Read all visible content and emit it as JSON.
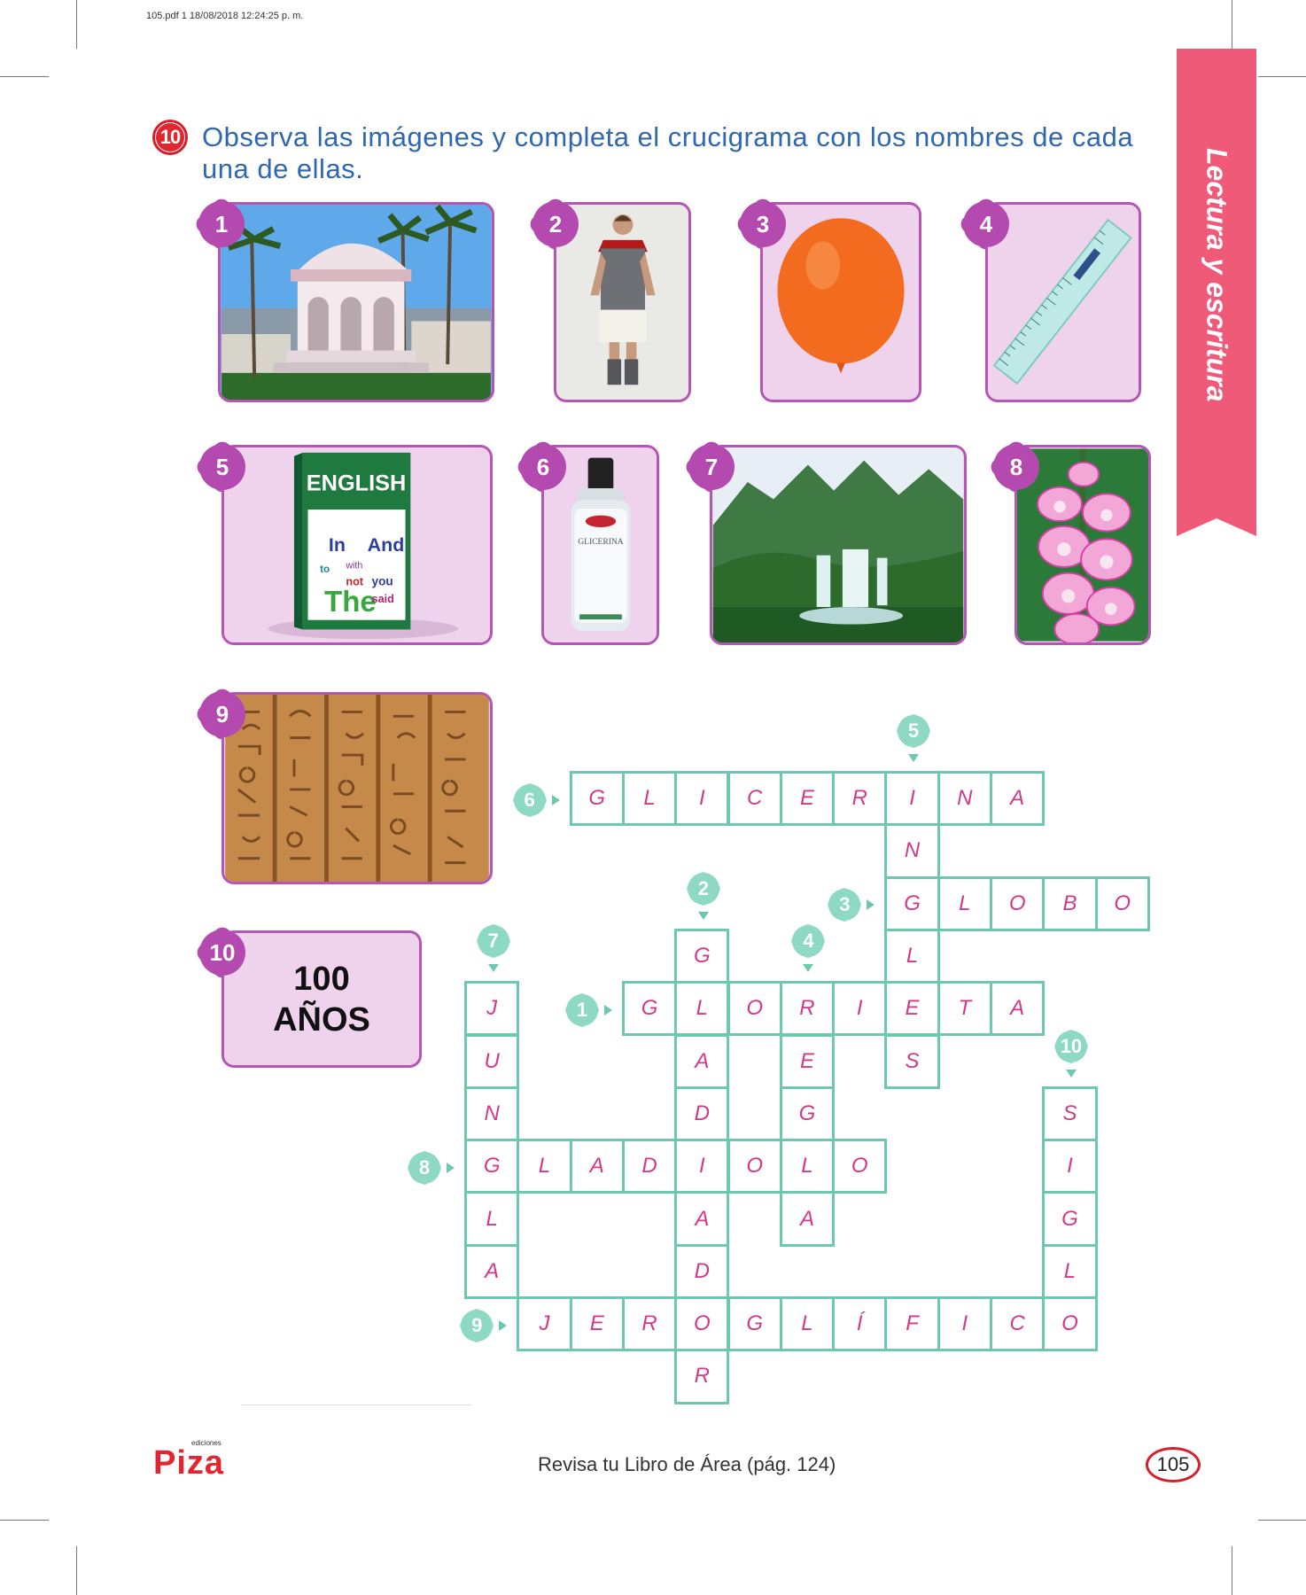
{
  "header": {
    "file_info": "105.pdf   1   18/08/2018   12:24:25 p. m."
  },
  "side_tab": {
    "label": "Lectura y escritura"
  },
  "exercise": {
    "number": "10",
    "instruction": "Observa las imágenes y completa el crucigrama con los nombres de cada una de ellas."
  },
  "images": [
    {
      "number": "1",
      "icon": "gazebo-photo"
    },
    {
      "number": "2",
      "icon": "gladiator-photo"
    },
    {
      "number": "3",
      "icon": "orange-balloon"
    },
    {
      "number": "4",
      "icon": "ruler"
    },
    {
      "number": "5",
      "icon": "english-book"
    },
    {
      "number": "6",
      "icon": "glycerin-bottle"
    },
    {
      "number": "7",
      "icon": "jungle-waterfall-photo"
    },
    {
      "number": "8",
      "icon": "gladiolus-flower"
    },
    {
      "number": "9",
      "icon": "hieroglyphics-photo"
    },
    {
      "number": "10",
      "icon": "text-card"
    }
  ],
  "book_cover": {
    "title": "ENGLISH",
    "words": [
      "In",
      "And",
      "The",
      "you",
      "said",
      "not",
      "to",
      "with"
    ]
  },
  "bottle_label": "GLICERINA",
  "card10": {
    "line1": "100",
    "line2": "AÑOS"
  },
  "crossword": {
    "cells": [
      {
        "r": 0,
        "c": 2,
        "ch": "G"
      },
      {
        "r": 0,
        "c": 3,
        "ch": "L"
      },
      {
        "r": 0,
        "c": 4,
        "ch": "I"
      },
      {
        "r": 0,
        "c": 5,
        "ch": "C"
      },
      {
        "r": 0,
        "c": 6,
        "ch": "E"
      },
      {
        "r": 0,
        "c": 7,
        "ch": "R"
      },
      {
        "r": 0,
        "c": 8,
        "ch": "I"
      },
      {
        "r": 0,
        "c": 9,
        "ch": "N"
      },
      {
        "r": 0,
        "c": 10,
        "ch": "A"
      },
      {
        "r": 1,
        "c": 8,
        "ch": "N"
      },
      {
        "r": 2,
        "c": 8,
        "ch": "G"
      },
      {
        "r": 2,
        "c": 9,
        "ch": "L"
      },
      {
        "r": 2,
        "c": 10,
        "ch": "O"
      },
      {
        "r": 2,
        "c": 11,
        "ch": "B"
      },
      {
        "r": 2,
        "c": 12,
        "ch": "O"
      },
      {
        "r": 3,
        "c": 4,
        "ch": "G"
      },
      {
        "r": 3,
        "c": 8,
        "ch": "L"
      },
      {
        "r": 4,
        "c": 0,
        "ch": "J"
      },
      {
        "r": 4,
        "c": 3,
        "ch": "G"
      },
      {
        "r": 4,
        "c": 4,
        "ch": "L"
      },
      {
        "r": 4,
        "c": 5,
        "ch": "O"
      },
      {
        "r": 4,
        "c": 6,
        "ch": "R"
      },
      {
        "r": 4,
        "c": 7,
        "ch": "I"
      },
      {
        "r": 4,
        "c": 8,
        "ch": "E"
      },
      {
        "r": 4,
        "c": 9,
        "ch": "T"
      },
      {
        "r": 4,
        "c": 10,
        "ch": "A"
      },
      {
        "r": 5,
        "c": 0,
        "ch": "U"
      },
      {
        "r": 5,
        "c": 4,
        "ch": "A"
      },
      {
        "r": 5,
        "c": 6,
        "ch": "E"
      },
      {
        "r": 5,
        "c": 8,
        "ch": "S"
      },
      {
        "r": 6,
        "c": 0,
        "ch": "N"
      },
      {
        "r": 6,
        "c": 4,
        "ch": "D"
      },
      {
        "r": 6,
        "c": 6,
        "ch": "G"
      },
      {
        "r": 6,
        "c": 11,
        "ch": "S"
      },
      {
        "r": 7,
        "c": 0,
        "ch": "G"
      },
      {
        "r": 7,
        "c": 1,
        "ch": "L"
      },
      {
        "r": 7,
        "c": 2,
        "ch": "A"
      },
      {
        "r": 7,
        "c": 3,
        "ch": "D"
      },
      {
        "r": 7,
        "c": 4,
        "ch": "I"
      },
      {
        "r": 7,
        "c": 5,
        "ch": "O"
      },
      {
        "r": 7,
        "c": 6,
        "ch": "L"
      },
      {
        "r": 7,
        "c": 7,
        "ch": "O"
      },
      {
        "r": 7,
        "c": 11,
        "ch": "I"
      },
      {
        "r": 8,
        "c": 0,
        "ch": "L"
      },
      {
        "r": 8,
        "c": 4,
        "ch": "A"
      },
      {
        "r": 8,
        "c": 6,
        "ch": "A"
      },
      {
        "r": 8,
        "c": 11,
        "ch": "G"
      },
      {
        "r": 9,
        "c": 0,
        "ch": "A"
      },
      {
        "r": 9,
        "c": 4,
        "ch": "D"
      },
      {
        "r": 9,
        "c": 11,
        "ch": "L"
      },
      {
        "r": 10,
        "c": 1,
        "ch": "J"
      },
      {
        "r": 10,
        "c": 2,
        "ch": "E"
      },
      {
        "r": 10,
        "c": 3,
        "ch": "R"
      },
      {
        "r": 10,
        "c": 4,
        "ch": "O"
      },
      {
        "r": 10,
        "c": 5,
        "ch": "G"
      },
      {
        "r": 10,
        "c": 6,
        "ch": "L"
      },
      {
        "r": 10,
        "c": 7,
        "ch": "Í"
      },
      {
        "r": 10,
        "c": 8,
        "ch": "F"
      },
      {
        "r": 10,
        "c": 9,
        "ch": "I"
      },
      {
        "r": 10,
        "c": 10,
        "ch": "C"
      },
      {
        "r": 10,
        "c": 11,
        "ch": "O"
      },
      {
        "r": 11,
        "c": 4,
        "ch": "R"
      }
    ],
    "clues": [
      {
        "n": "6",
        "dir": "across",
        "r": 0,
        "c": 2
      },
      {
        "n": "5",
        "dir": "down",
        "r": 0,
        "c": 8
      },
      {
        "n": "3",
        "dir": "across",
        "r": 2,
        "c": 8
      },
      {
        "n": "2",
        "dir": "down",
        "r": 3,
        "c": 4
      },
      {
        "n": "4",
        "dir": "down",
        "r": 4,
        "c": 6
      },
      {
        "n": "7",
        "dir": "down",
        "r": 4,
        "c": 0
      },
      {
        "n": "1",
        "dir": "across",
        "r": 4,
        "c": 3
      },
      {
        "n": "10",
        "dir": "down",
        "r": 6,
        "c": 11
      },
      {
        "n": "8",
        "dir": "across",
        "r": 7,
        "c": 0
      },
      {
        "n": "9",
        "dir": "across",
        "r": 10,
        "c": 1
      }
    ]
  },
  "footer": {
    "publisher": "Piza",
    "publisher_small": "ediciones",
    "note": "Revisa tu Libro de Área (pág. 124)",
    "page_number": "105"
  }
}
